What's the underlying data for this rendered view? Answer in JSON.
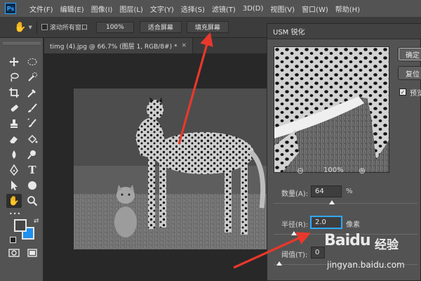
{
  "menubar": {
    "logo": "Ps",
    "items": [
      "文件(F)",
      "编辑(E)",
      "图像(I)",
      "图层(L)",
      "文字(Y)",
      "选择(S)",
      "滤镜(T)",
      "3D(D)",
      "视图(V)",
      "窗口(W)",
      "帮助(H)"
    ]
  },
  "options": {
    "scroll_all_label": "滚动所有窗口",
    "zoom_value": "100%",
    "fit_screen_label": "适合屏幕",
    "fill_screen_label": "填充屏幕"
  },
  "tab": {
    "title": "timg (4).jpg @ 66.7% (图层 1, RGB/8#) *",
    "close": "×"
  },
  "tools": {
    "type_glyph": "T",
    "more_glyph": "•••"
  },
  "dialog": {
    "title": "USM 锐化",
    "ok_label": "确定",
    "reset_label": "复位",
    "preview_label": "预览",
    "preview_checked": true,
    "zoom_level": "100%",
    "zoom_out_glyph": "⊖",
    "zoom_in_glyph": "⊕",
    "amount": {
      "label": "数量(A):",
      "value": "64",
      "unit": "%"
    },
    "radius": {
      "label": "半径(R):",
      "value": "2.0",
      "unit": "像素"
    },
    "threshold": {
      "label": "阈值(T):",
      "value": "0"
    }
  },
  "watermark": {
    "logo": "Bai",
    "logo_paw": "du",
    "text": "经验",
    "url": "jingyan.baidu.com"
  },
  "colors": {
    "foreground": "#464646",
    "background": "#1e90ee",
    "arrow": "#e8382c"
  }
}
